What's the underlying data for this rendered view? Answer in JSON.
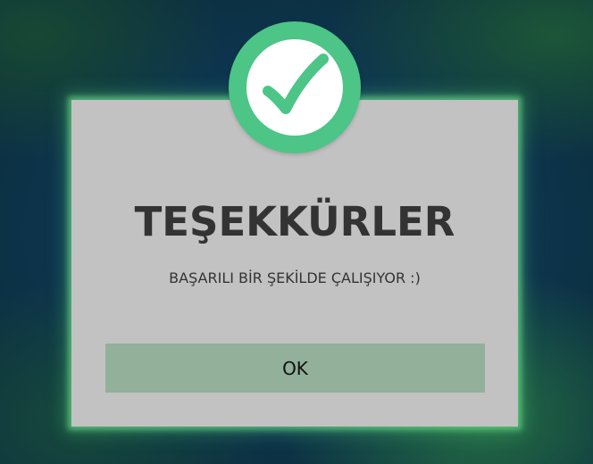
{
  "dialog": {
    "title": "TEŞEKKÜRLER",
    "message": "BAŞARILI BİR ŞEKİLDE ÇALIŞIYOR :)",
    "ok_label": "OK",
    "icon": "checkmark-icon"
  },
  "colors": {
    "accent": "#4cc587",
    "dialog_background": "#c2c2c2",
    "button_background": "#93b09a",
    "text": "#333333",
    "glow": "#78f096"
  }
}
